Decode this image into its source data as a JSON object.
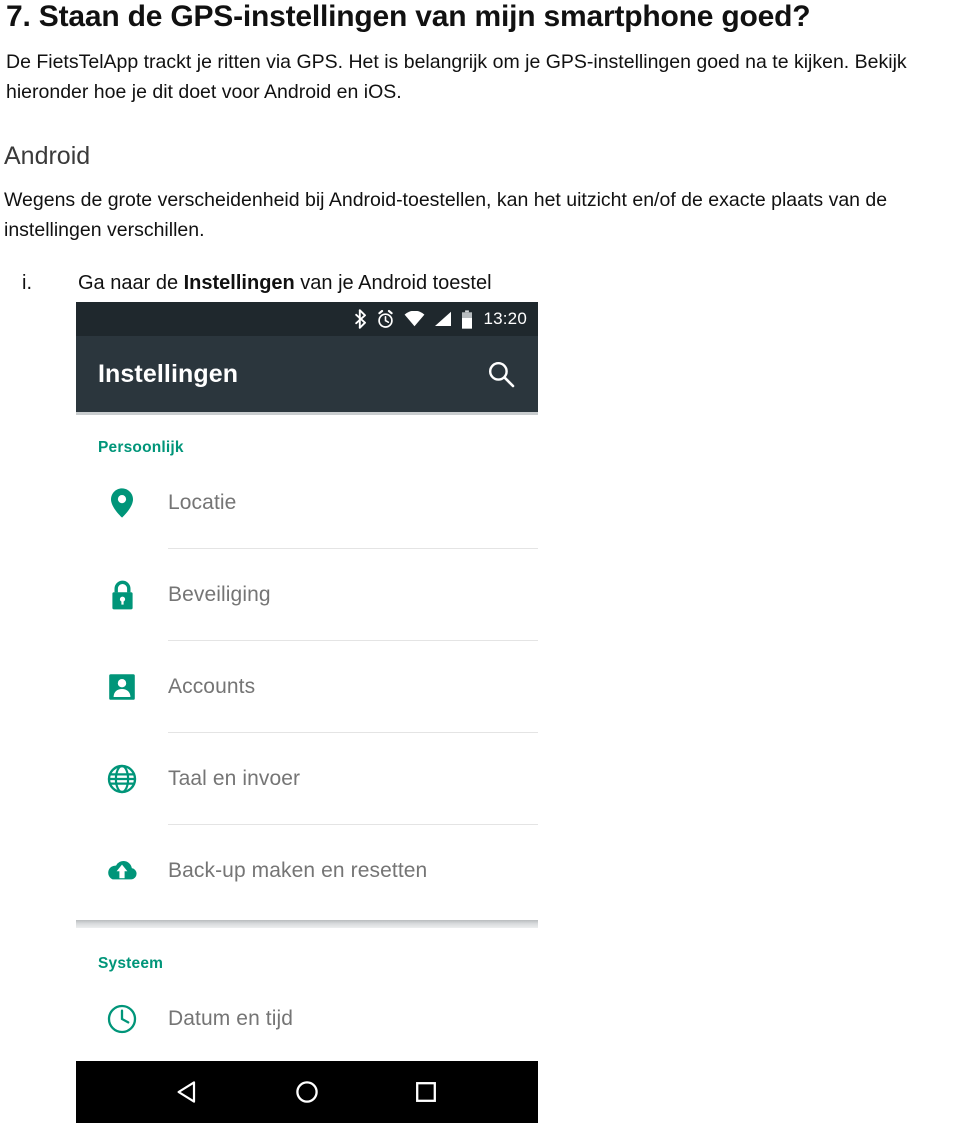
{
  "document": {
    "title": "7. Staan de GPS-instellingen van mijn smartphone goed?",
    "intro": "De FietsTelApp trackt je ritten via GPS. Het is belangrijk om je GPS-instellingen goed na te kijken. Bekijk hieronder hoe je dit doet voor Android en iOS.",
    "subheading": "Android",
    "paragraph2": "Wegens de grote verscheidenheid bij Android-toestellen, kan het uitzicht en/of de exacte plaats van de instellingen verschillen.",
    "step": {
      "marker": "i.",
      "text_before": "Ga naar de ",
      "text_bold": "Instellingen",
      "text_after": " van je Android toestel"
    }
  },
  "phone": {
    "status_bar": {
      "time": "13:20",
      "icons": [
        "bluetooth-icon",
        "alarm-icon",
        "wifi-icon",
        "cellular-signal-icon",
        "battery-icon"
      ]
    },
    "toolbar": {
      "title": "Instellingen",
      "search_icon": "search-icon"
    },
    "sections": [
      {
        "header": "Persoonlijk",
        "items": [
          {
            "label": "Locatie",
            "icon": "location-pin-icon"
          },
          {
            "label": "Beveiliging",
            "icon": "lock-icon"
          },
          {
            "label": "Accounts",
            "icon": "person-icon"
          },
          {
            "label": "Taal en invoer",
            "icon": "globe-icon"
          },
          {
            "label": "Back-up maken en resetten",
            "icon": "cloud-upload-icon"
          }
        ]
      },
      {
        "header": "Systeem",
        "items": [
          {
            "label": "Datum en tijd",
            "icon": "clock-icon"
          }
        ]
      }
    ],
    "nav_bar": {
      "back": "back-triangle-icon",
      "home": "home-circle-icon",
      "recents": "recents-square-icon"
    }
  },
  "colors": {
    "accent_teal": "#009579",
    "status_bar_bg": "#1f282d",
    "toolbar_bg": "#2b363d",
    "list_label": "#757575",
    "nav_bar_bg": "#000000"
  }
}
